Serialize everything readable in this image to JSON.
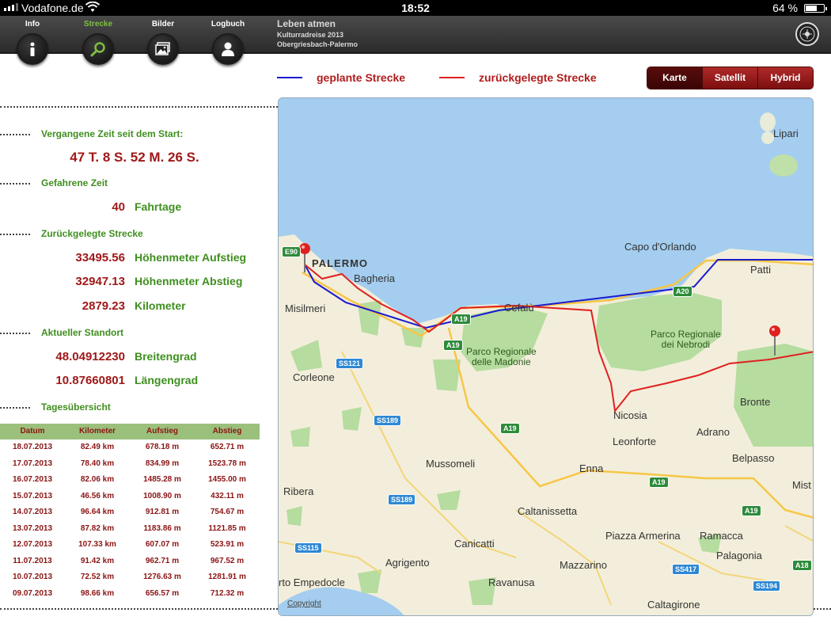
{
  "status_bar": {
    "carrier": "Vodafone.de",
    "time": "18:52",
    "battery": "64 %",
    "battery_level": 0.64
  },
  "toolbar": {
    "tabs": [
      {
        "label": "Info",
        "icon": "info-icon"
      },
      {
        "label": "Strecke",
        "icon": "search-icon",
        "active": true
      },
      {
        "label": "Bilder",
        "icon": "photos-icon"
      },
      {
        "label": "Logbuch",
        "icon": "person-icon"
      }
    ],
    "trip": {
      "title": "Leben atmen",
      "subtitle": "Kulturradreise 2013",
      "route": "Obergriesbach-Palermo"
    },
    "logo_icon": "club-logo-icon"
  },
  "legend": {
    "planned": {
      "label": "geplante Strecke",
      "color": "#1a1ad0"
    },
    "traveled": {
      "label": "zurückgelegte Strecke",
      "color": "#e02020"
    }
  },
  "map_type": {
    "options": [
      "Karte",
      "Satellit",
      "Hybrid"
    ],
    "selected": "Karte"
  },
  "stats": {
    "elapsed_heading": "Vergangene Zeit seit dem Start:",
    "elapsed_value": "47 T. 8 S. 52 M. 26 S.",
    "driven_heading": "Gefahrene Zeit",
    "driven_value": "40",
    "driven_unit": "Fahrtage",
    "distance_heading": "Zurückgelegte Strecke",
    "ascent_value": "33495.56",
    "ascent_unit": "Höhenmeter Aufstieg",
    "descent_value": "32947.13",
    "descent_unit": "Höhenmeter Abstieg",
    "km_value": "2879.23",
    "km_unit": "Kilometer",
    "location_heading": "Aktueller Standort",
    "lat_value": "48.04912230",
    "lat_unit": "Breitengrad",
    "lon_value": "10.87660801",
    "lon_unit": "Längengrad",
    "daily_heading": "Tagesübersicht"
  },
  "daily_table": {
    "headers": [
      "Datum",
      "Kilometer",
      "Aufstieg",
      "Abstieg"
    ],
    "rows": [
      [
        "18.07.2013",
        "82.49 km",
        "678.18 m",
        "652.71 m"
      ],
      [
        "17.07.2013",
        "78.40 km",
        "834.99 m",
        "1523.78 m"
      ],
      [
        "16.07.2013",
        "82.06 km",
        "1485.28 m",
        "1455.00 m"
      ],
      [
        "15.07.2013",
        "46.56 km",
        "1008.90 m",
        "432.11 m"
      ],
      [
        "14.07.2013",
        "96.64 km",
        "912.81 m",
        "754.67 m"
      ],
      [
        "13.07.2013",
        "87.82 km",
        "1183.86 m",
        "1121.85 m"
      ],
      [
        "12.07.2013",
        "107.33 km",
        "607.07 m",
        "523.91 m"
      ],
      [
        "11.07.2013",
        "91.42 km",
        "962.71 m",
        "967.52 m"
      ],
      [
        "10.07.2013",
        "72.52 km",
        "1276.63 m",
        "1281.91 m"
      ],
      [
        "09.07.2013",
        "98.66 km",
        "656.57 m",
        "712.32 m"
      ]
    ]
  },
  "map": {
    "cities": [
      "Lipari",
      "Capo d'Orlando",
      "PALERMO",
      "Patti",
      "Bagheria",
      "Misilmeri",
      "Cefalù",
      "Corleone",
      "Nicosia",
      "Bronte",
      "Adrano",
      "Leonforte",
      "Mussomeli",
      "Enna",
      "Belpasso",
      "Ribera",
      "Caltanissetta",
      "Mist",
      "Canicatti",
      "Piazza Armerina",
      "Ramacca",
      "Agrigento",
      "Palagonia",
      "Mazzarino",
      "rto Empedocle",
      "Ravanusa",
      "Caltagirone"
    ],
    "parks": [
      "Parco Regionale\ndelle Madonie",
      "Parco Regionale\ndei Nebrodi"
    ],
    "roads": [
      "E90",
      "A20",
      "A19",
      "SS121",
      "SS189",
      "A19",
      "A19",
      "SS189",
      "A19",
      "A19",
      "SS115",
      "SS417",
      "SS194",
      "A18",
      "A20"
    ],
    "copyright": "Copyright"
  }
}
